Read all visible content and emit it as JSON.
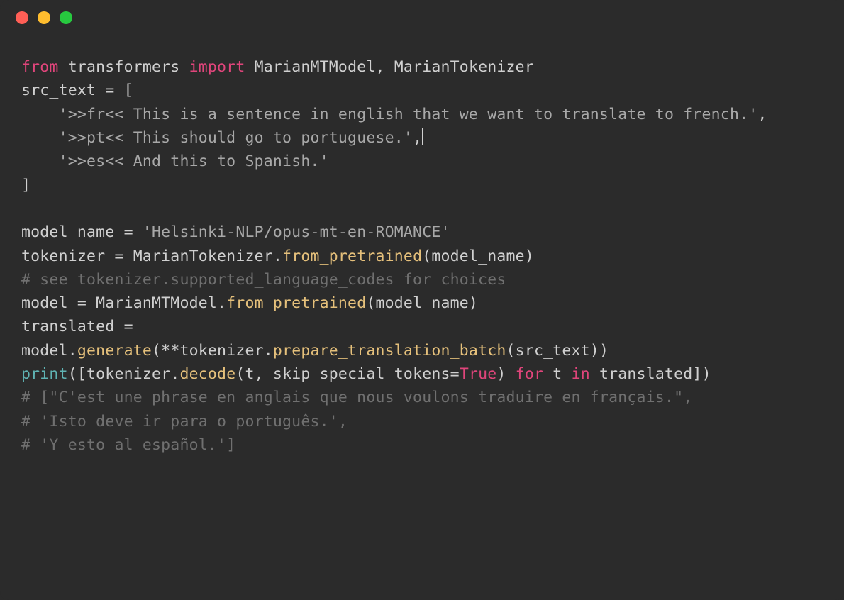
{
  "titlebar": {
    "close_icon": "close",
    "minimize_icon": "minimize",
    "maximize_icon": "maximize"
  },
  "code": {
    "line1_from": "from",
    "line1_mod": " transformers ",
    "line1_import": "import",
    "line1_rest": " MarianMTModel, MarianTokenizer",
    "line2": "src_text = [",
    "line3a": "    ",
    "line3b": "'>>fr<< This is a sentence in english that we want to translate to french.'",
    "line3c": ",",
    "line4a": "    ",
    "line4b": "'>>pt<< This should go to portuguese.'",
    "line4c": ",",
    "line5a": "    ",
    "line5b": "'>>es<< And this to Spanish.'",
    "line6": "]",
    "blank": "",
    "line8a": "model_name = ",
    "line8b": "'Helsinki-NLP/opus-mt-en-ROMANCE'",
    "line9a": "tokenizer = MarianTokenizer.",
    "line9b": "from_pretrained",
    "line9c": "(model_name)",
    "line10": "# see tokenizer.supported_language_codes for choices",
    "line11a": "model = MarianMTModel.",
    "line11b": "from_pretrained",
    "line11c": "(model_name)",
    "line12": "translated = ",
    "line13a": "model.",
    "line13b": "generate",
    "line13c": "(**tokenizer.",
    "line13d": "prepare_translation_batch",
    "line13e": "(src_text))",
    "line14a": "print",
    "line14b": "([tokenizer.",
    "line14c": "decode",
    "line14d": "(t, skip_special_tokens=",
    "line14e": "True",
    "line14f": ") ",
    "line14g": "for",
    "line14h": " t ",
    "line14i": "in",
    "line14j": " translated])",
    "line15": "# [\"C'est une phrase en anglais que nous voulons traduire en français.\",",
    "line16": "# 'Isto deve ir para o português.',",
    "line17": "# 'Y esto al español.']"
  }
}
